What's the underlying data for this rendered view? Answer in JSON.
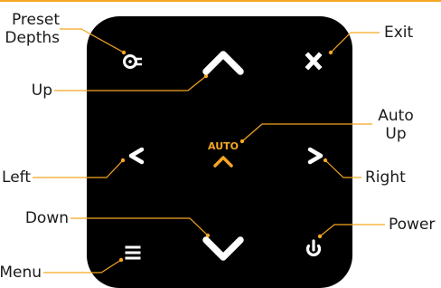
{
  "colors": {
    "accent": "#f5a623",
    "panel": "#000000",
    "icon": "#ffffff",
    "label": "#1a1a1a"
  },
  "labels": {
    "preset_depths_line1": "Preset",
    "preset_depths_line2": "Depths",
    "exit": "Exit",
    "up": "Up",
    "auto_up_line1": "Auto",
    "auto_up_line2": "Up",
    "left": "Left",
    "right": "Right",
    "down": "Down",
    "power": "Power",
    "menu": "Menu"
  },
  "buttons": {
    "auto_text": "AUTO"
  },
  "icons": [
    "preset-depths-icon",
    "chevron-up-icon",
    "close-icon",
    "chevron-left-icon",
    "auto-up-icon",
    "chevron-right-icon",
    "chevron-down-icon",
    "menu-icon",
    "power-icon"
  ]
}
